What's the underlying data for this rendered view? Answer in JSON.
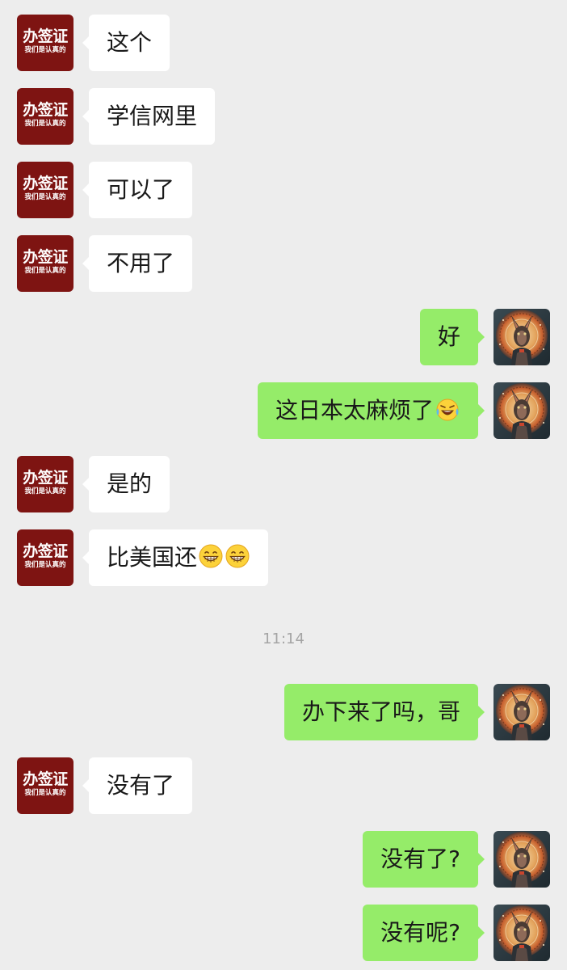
{
  "contact": {
    "avatar_brand_title": "办签证",
    "avatar_brand_subtitle": "我们是认真的"
  },
  "messages": [
    {
      "side": "left",
      "text": "这个"
    },
    {
      "side": "left",
      "text": "学信网里"
    },
    {
      "side": "left",
      "text": "可以了"
    },
    {
      "side": "left",
      "text": "不用了"
    },
    {
      "side": "right",
      "text": "好"
    },
    {
      "side": "right",
      "text": "这日本太麻烦了",
      "emoji": [
        "crying-laughing-emoji"
      ]
    },
    {
      "side": "left",
      "text": "是的"
    },
    {
      "side": "left",
      "text": "比美国还",
      "emoji": [
        "grinning-emoji",
        "grinning-emoji"
      ]
    },
    {
      "side": "right",
      "text": "办下来了吗，哥"
    },
    {
      "side": "left",
      "text": "没有了"
    },
    {
      "side": "right",
      "text": "没有了?"
    },
    {
      "side": "right",
      "text": "没有呢?"
    }
  ],
  "timestamp": "11:14",
  "colors": {
    "background": "#ededed",
    "incoming_bubble": "#ffffff",
    "outgoing_bubble": "#95ec69",
    "brand_avatar": "#7e1412"
  }
}
